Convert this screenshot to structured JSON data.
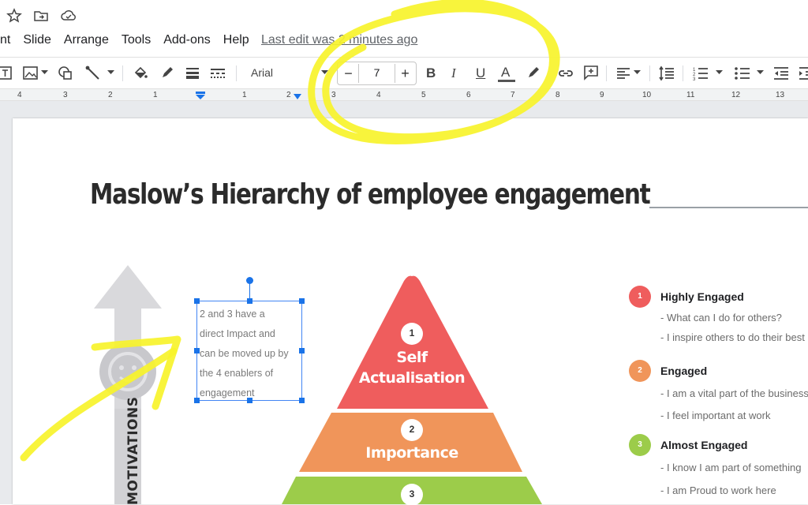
{
  "menu": {
    "items": [
      "nt",
      "Slide",
      "Arrange",
      "Tools",
      "Add-ons",
      "Help"
    ],
    "last_edit": "Last edit was 2 minutes ago"
  },
  "toolbar": {
    "font_name": "Arial",
    "font_size": "7",
    "minus": "−",
    "plus": "+",
    "bold": "B",
    "italic": "I",
    "underline": "U",
    "text_color": "A"
  },
  "ruler": {
    "numbers": [
      "4",
      "3",
      "2",
      "1",
      "1",
      "2",
      "3",
      "4",
      "5",
      "6",
      "7",
      "8",
      "9",
      "10",
      "11",
      "12",
      "13"
    ]
  },
  "slide": {
    "title": "Maslow’s Hierarchy of employee engagement",
    "textbox": [
      "2 and 3 have a",
      "direct Impact and",
      "can be moved up by",
      "the 4 enablers of",
      "engagement"
    ],
    "arrow_label": "MOTIVATIONS",
    "pyramid": [
      {
        "num": "1",
        "label_line1": "Self",
        "label_line2": "Actualisation",
        "color": "#ef5d5d"
      },
      {
        "num": "2",
        "label_line1": "Importance",
        "color": "#f0955a"
      },
      {
        "num": "3",
        "color": "#9ccc4a"
      }
    ],
    "legend": [
      {
        "num": "1",
        "title": "Highly Engaged",
        "color": "#ef5d5d",
        "lines": [
          "- What can I do for others?",
          "- I inspire others to do their best"
        ]
      },
      {
        "num": "2",
        "title": "Engaged",
        "color": "#f0955a",
        "lines": [
          "- I am a vital part of the business",
          "- I feel important at work"
        ]
      },
      {
        "num": "3",
        "title": "Almost Engaged",
        "color": "#9ccc4a",
        "lines": [
          "- I know I am part of something",
          "- I am Proud to work here"
        ]
      }
    ]
  },
  "colors": {
    "annotation": "#f7f32b",
    "selection": "#1a73e8"
  }
}
